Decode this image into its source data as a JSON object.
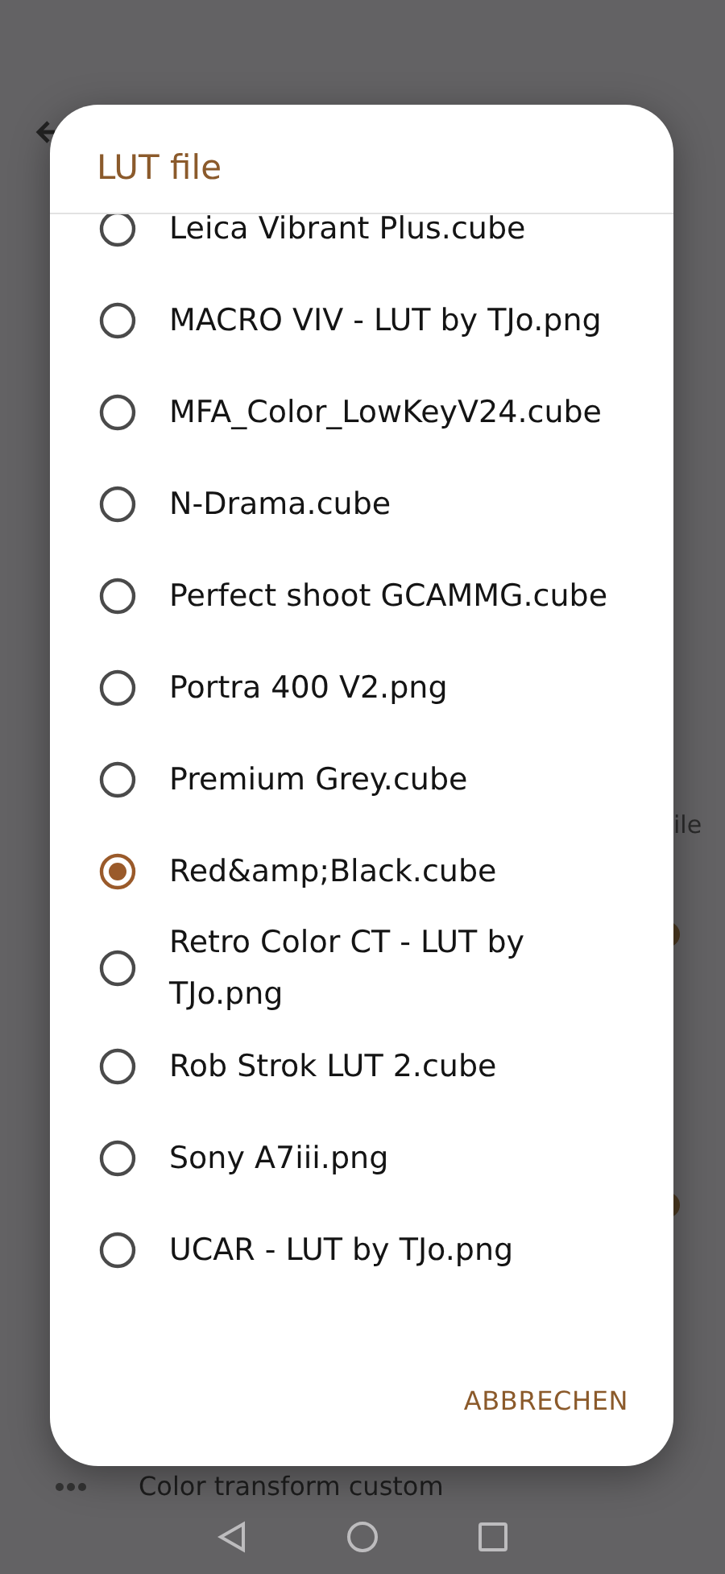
{
  "background": {
    "side_text": "ile",
    "row_label": "Color transform custom"
  },
  "dialog": {
    "title": "LUT file",
    "options": [
      {
        "label": "Leica Vibrant Plus.cube",
        "selected": false
      },
      {
        "label": "MACRO VIV - LUT by TJo.png",
        "selected": false
      },
      {
        "label": "MFA_Color_LowKeyV24.cube",
        "selected": false
      },
      {
        "label": "N-Drama.cube",
        "selected": false
      },
      {
        "label": "Perfect shoot GCAMMG.cube",
        "selected": false
      },
      {
        "label": "Portra 400 V2.png",
        "selected": false
      },
      {
        "label": "Premium Grey.cube",
        "selected": false
      },
      {
        "label": "Red&amp;Black.cube",
        "selected": true
      },
      {
        "label": "Retro Color CT - LUT by TJo.png",
        "selected": false
      },
      {
        "label": "Rob Strok LUT 2.cube",
        "selected": false
      },
      {
        "label": "Sony A7iii.png",
        "selected": false
      },
      {
        "label": "UCAR - LUT by TJo.png",
        "selected": false
      }
    ],
    "cancel_button": "ABBRECHEN"
  }
}
